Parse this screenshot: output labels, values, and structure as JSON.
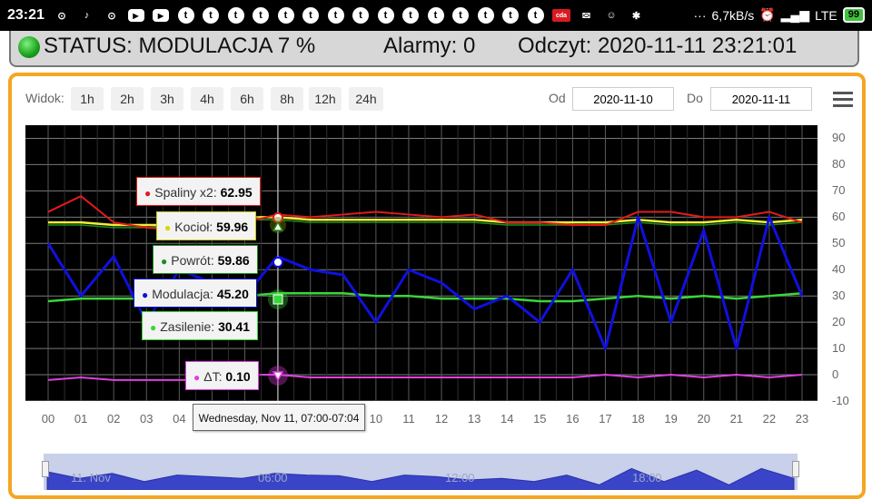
{
  "status_bar": {
    "time": "23:21",
    "net_speed": "6,7kB/s",
    "signal": "LTE",
    "battery": "99",
    "more": "···",
    "app_icons": [
      "location-icon",
      "tiktok-icon",
      "location-icon",
      "youtube-icon",
      "youtube-icon",
      "t-icon",
      "t-icon",
      "t-icon",
      "t-icon",
      "t-icon",
      "t-icon",
      "t-icon",
      "t-icon",
      "t-icon",
      "t-icon",
      "t-icon",
      "t-icon",
      "t-icon",
      "t-icon",
      "t-icon",
      "cda-icon",
      "gmail-icon",
      "smile-icon",
      "android-icon"
    ]
  },
  "header": {
    "status": "STATUS: MODULACJA 7 %",
    "alarms": "Alarmy: 0",
    "reading": "Odczyt: 2020-11-11 23:21:01",
    "led_color": "#22b022"
  },
  "toolbar": {
    "view_label": "Widok:",
    "views": [
      "1h",
      "2h",
      "3h",
      "4h",
      "6h",
      "8h",
      "12h",
      "24h"
    ],
    "from_label": "Od",
    "from_value": "2020-11-10",
    "to_label": "Do",
    "to_value": "2020-11-11"
  },
  "tooltips": {
    "spaliny": {
      "label": "Spaliny x2: ",
      "value": "62.95",
      "color": "#e41a1c"
    },
    "kociol": {
      "label": "Kocioł: ",
      "value": "59.96",
      "color": "#d8d800"
    },
    "powrot": {
      "label": "Powrót: ",
      "value": "59.86",
      "color": "#1e8c1e"
    },
    "modulacja": {
      "label": "Modulacja: ",
      "value": "45.20",
      "color": "#1010d0"
    },
    "zasilenie": {
      "label": "Zasilenie: ",
      "value": "30.41",
      "color": "#39d739"
    },
    "delta": {
      "label": "ΔT: ",
      "value": "0.10",
      "color": "#e040e0"
    },
    "time": "Wednesday, Nov 11, 07:00-07:04"
  },
  "navigator": {
    "labels": [
      "11. Nov",
      "06:00",
      "12:00",
      "18:00"
    ]
  },
  "chart_data": {
    "type": "line",
    "x": [
      "00",
      "01",
      "02",
      "03",
      "04",
      "05",
      "06",
      "07",
      "08",
      "09",
      "10",
      "11",
      "12",
      "13",
      "14",
      "15",
      "16",
      "17",
      "18",
      "19",
      "20",
      "21",
      "22",
      "23"
    ],
    "ylim": [
      -10,
      95
    ],
    "yticks": [
      "90",
      "80",
      "70",
      "60",
      "50",
      "40",
      "30",
      "20",
      "10",
      "0",
      "-10"
    ],
    "series": [
      {
        "name": "Spaliny x2",
        "color": "#e41a1c",
        "values": [
          62,
          68,
          58,
          56,
          55,
          55,
          58,
          61,
          60,
          61,
          62,
          61,
          60,
          61,
          58,
          58,
          57,
          57,
          62,
          62,
          60,
          60,
          62,
          58
        ]
      },
      {
        "name": "Kocioł",
        "color": "#eded3a",
        "values": [
          58,
          58,
          57,
          57,
          57,
          58,
          60,
          60,
          59,
          59,
          59,
          59,
          59,
          59,
          58,
          58,
          58,
          58,
          59,
          58,
          58,
          59,
          58,
          59
        ]
      },
      {
        "name": "Powrót",
        "color": "#1e8c1e",
        "values": [
          57,
          57,
          56,
          56,
          57,
          57,
          59,
          59,
          58,
          58,
          58,
          58,
          58,
          58,
          57,
          57,
          57,
          57,
          58,
          57,
          57,
          58,
          57,
          58
        ]
      },
      {
        "name": "Modulacja",
        "color": "#1010e0",
        "values": [
          50,
          30,
          45,
          20,
          40,
          35,
          30,
          45,
          40,
          38,
          20,
          40,
          35,
          25,
          30,
          20,
          40,
          10,
          60,
          20,
          55,
          10,
          60,
          30
        ]
      },
      {
        "name": "Zasilenie",
        "color": "#39d739",
        "values": [
          28,
          29,
          29,
          29,
          29,
          30,
          30,
          31,
          31,
          31,
          30,
          30,
          29,
          29,
          29,
          28,
          28,
          29,
          30,
          29,
          30,
          29,
          30,
          31
        ]
      },
      {
        "name": "ΔT",
        "color": "#e040e0",
        "values": [
          -2,
          -1,
          -2,
          -2,
          -2,
          -2,
          0,
          0,
          -1,
          -1,
          -1,
          -1,
          -1,
          -1,
          -1,
          -1,
          -1,
          0,
          -1,
          0,
          -1,
          0,
          -1,
          0
        ]
      }
    ]
  }
}
